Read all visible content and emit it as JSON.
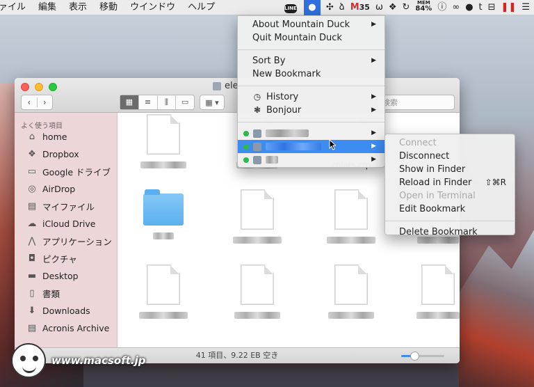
{
  "menubar": {
    "items": [
      "ァイル",
      "編集",
      "表示",
      "移動",
      "ウインドウ",
      "ヘルプ"
    ],
    "status_icons": {
      "line": "LINE",
      "gmail_count": "35",
      "mem_label": "MEM",
      "mem_value": "84%"
    }
  },
  "finder": {
    "title": "ele",
    "search_placeholder": "検索",
    "sidebar": {
      "heading": "よく使う項目",
      "items": [
        {
          "label": "home",
          "icon": "home-icon"
        },
        {
          "label": "Dropbox",
          "icon": "dropbox-icon"
        },
        {
          "label": "Google ドライブ",
          "icon": "folder-icon"
        },
        {
          "label": "AirDrop",
          "icon": "airdrop-icon"
        },
        {
          "label": "マイファイル",
          "icon": "all-files-icon"
        },
        {
          "label": "iCloud Drive",
          "icon": "cloud-icon"
        },
        {
          "label": "アプリケーション",
          "icon": "applications-icon"
        },
        {
          "label": "ピクチャ",
          "icon": "camera-icon"
        },
        {
          "label": "Desktop",
          "icon": "desktop-icon"
        },
        {
          "label": "書類",
          "icon": "documents-icon"
        },
        {
          "label": "Downloads",
          "icon": "downloads-icon"
        },
        {
          "label": "Acronis Archive",
          "icon": "archive-icon"
        }
      ]
    },
    "visible_file_label": "colors.ctp",
    "status_text": "41 項目、9.22 EB 空き",
    "icon_size_level": 0.3
  },
  "duck_menu": {
    "items": {
      "about": "About Mountain Duck",
      "quit": "Quit Mountain Duck",
      "sort_by": "Sort By",
      "new_bookmark": "New Bookmark",
      "history": "History",
      "bonjour": "Bonjour"
    }
  },
  "bookmark_submenu": {
    "connect": "Connect",
    "disconnect": "Disconnect",
    "show_in_finder": "Show in Finder",
    "reload_in_finder": "Reload in Finder",
    "reload_shortcut": "⇧⌘R",
    "open_in_terminal": "Open in Terminal",
    "edit_bookmark": "Edit Bookmark",
    "delete_bookmark": "Delete Bookmark"
  },
  "watermark": "www.macsoft.jp",
  "colors": {
    "highlight": "#3d8cf2",
    "status_green": "#2db84b"
  }
}
